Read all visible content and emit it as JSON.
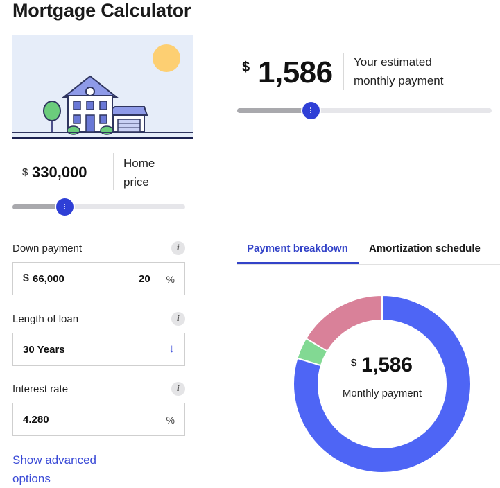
{
  "page": {
    "title": "Mortgage Calculator"
  },
  "home_price": {
    "currency": "$",
    "value": "330,000",
    "label": "Home price",
    "slider_fraction": 0.3
  },
  "down_payment": {
    "label": "Down payment",
    "info": "i",
    "currency": "$",
    "value": "66,000",
    "percent": "20",
    "percent_symbol": "%"
  },
  "loan_length": {
    "label": "Length of loan",
    "info": "i",
    "value": "30 Years",
    "arrow": "↓"
  },
  "interest_rate": {
    "label": "Interest rate",
    "info": "i",
    "value": "4.280",
    "percent_symbol": "%"
  },
  "advanced_link": "Show advanced options",
  "payment": {
    "currency": "$",
    "value": "1,586",
    "label": "Your estimated monthly payment",
    "slider_fraction": 0.29
  },
  "tabs": [
    {
      "label": "Payment breakdown",
      "active": true
    },
    {
      "label": "Amortization schedule",
      "active": false
    }
  ],
  "donut": {
    "currency": "$",
    "value": "1,586",
    "label": "Monthly payment",
    "segments": [
      {
        "fraction": 0.797,
        "color": "#4e65f5"
      },
      {
        "fraction": 0.039,
        "color": "#82d993"
      },
      {
        "fraction": 0.164,
        "color": "#d98199"
      }
    ]
  },
  "colors": {
    "accent": "#3343c8",
    "thumb": "#2f3fd6",
    "link": "#3a4ad6"
  }
}
